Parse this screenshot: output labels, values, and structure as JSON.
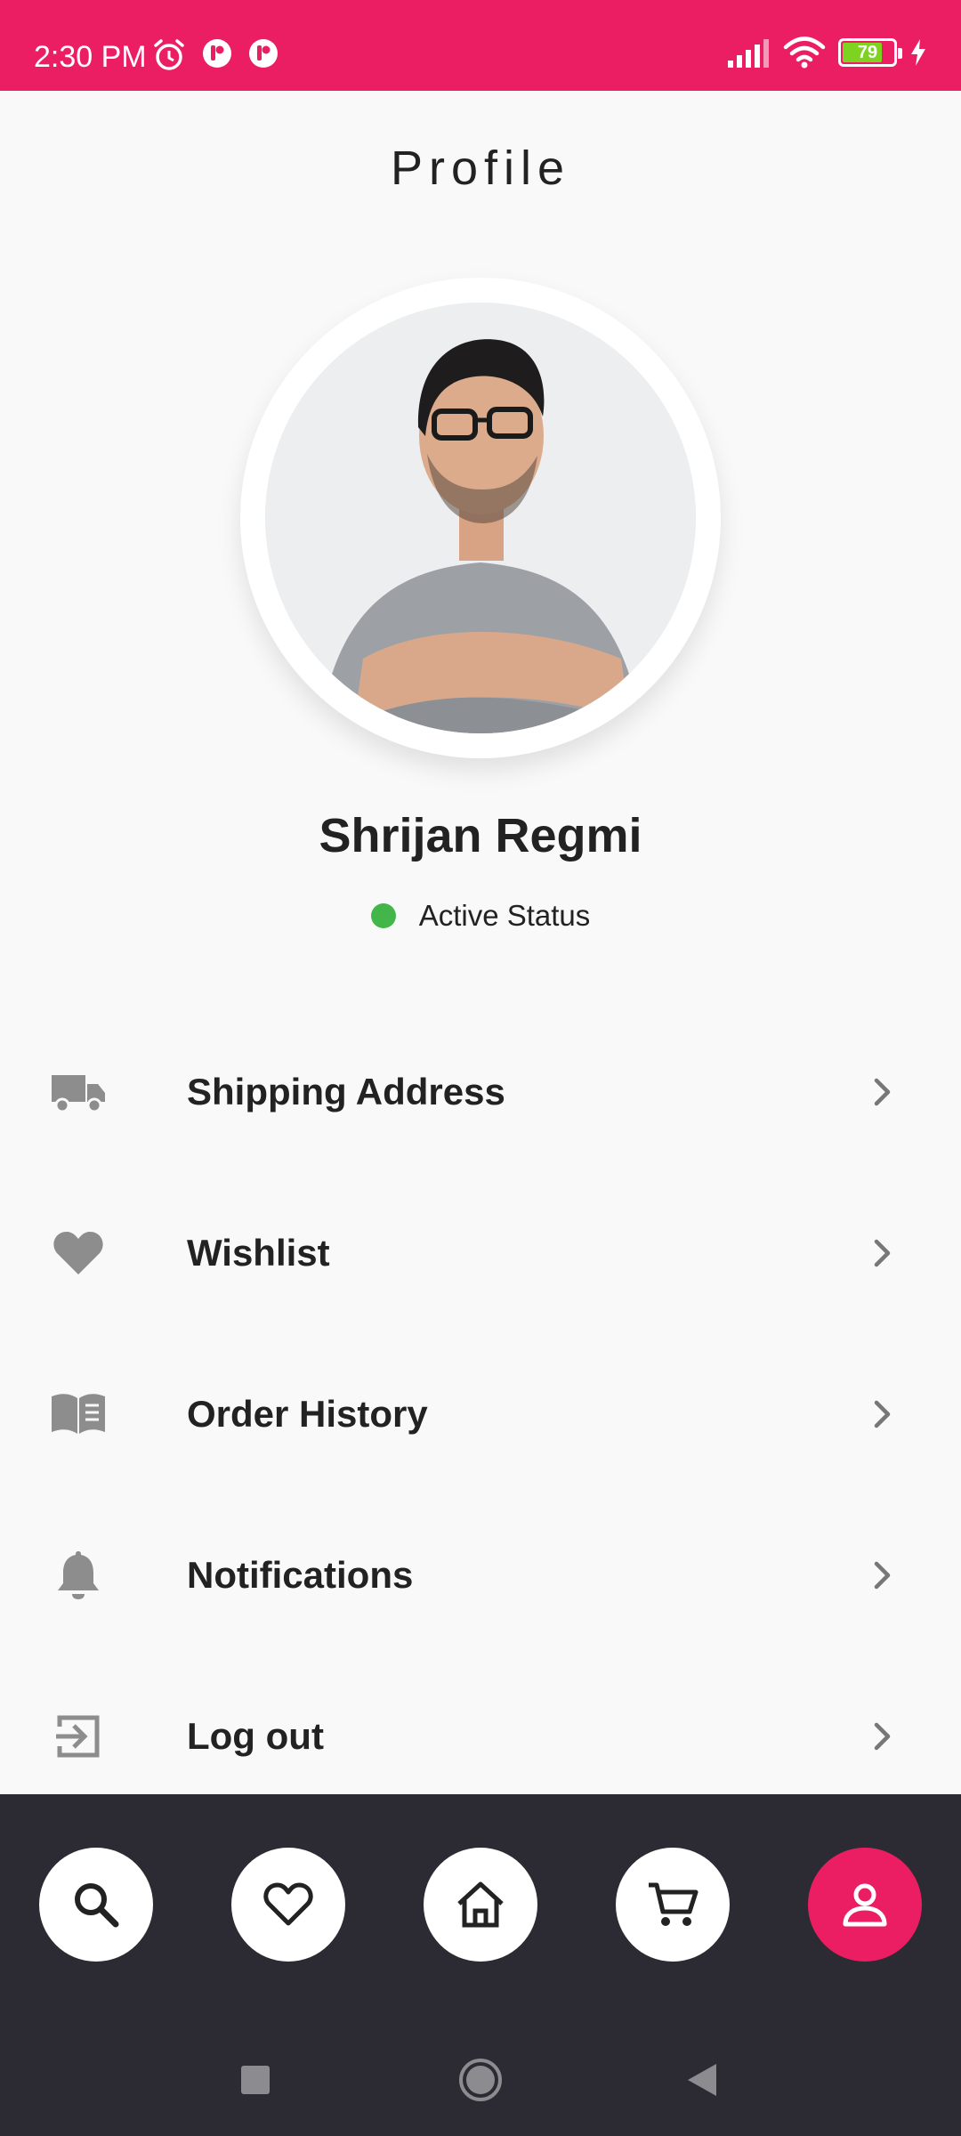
{
  "status_bar": {
    "time": "2:30 PM",
    "battery_level": "79",
    "battery_fraction": 0.79,
    "icons": [
      "alarm-icon",
      "app-notification-icon",
      "app-notification-icon",
      "signal-icon",
      "wifi-icon",
      "battery-icon",
      "charging-icon"
    ],
    "background_color": "#ec1e63"
  },
  "header": {
    "title": "Profile"
  },
  "profile": {
    "name": "Shrijan Regmi",
    "status_label": "Active Status",
    "status_color": "#43b649"
  },
  "menu": {
    "items": [
      {
        "label": "Shipping Address",
        "icon": "truck-icon"
      },
      {
        "label": "Wishlist",
        "icon": "heart-icon"
      },
      {
        "label": "Order History",
        "icon": "book-icon"
      },
      {
        "label": "Notifications",
        "icon": "bell-icon"
      },
      {
        "label": "Log out",
        "icon": "logout-icon"
      }
    ]
  },
  "bottom_nav": {
    "items": [
      "search-icon",
      "heart-outline-icon",
      "home-icon",
      "cart-icon",
      "person-icon"
    ],
    "active": "person-icon",
    "active_color": "#ec1e63",
    "background_color": "#2c2b33"
  },
  "system_nav": {
    "items": [
      "recents-icon",
      "home-circle-icon",
      "back-icon"
    ]
  }
}
